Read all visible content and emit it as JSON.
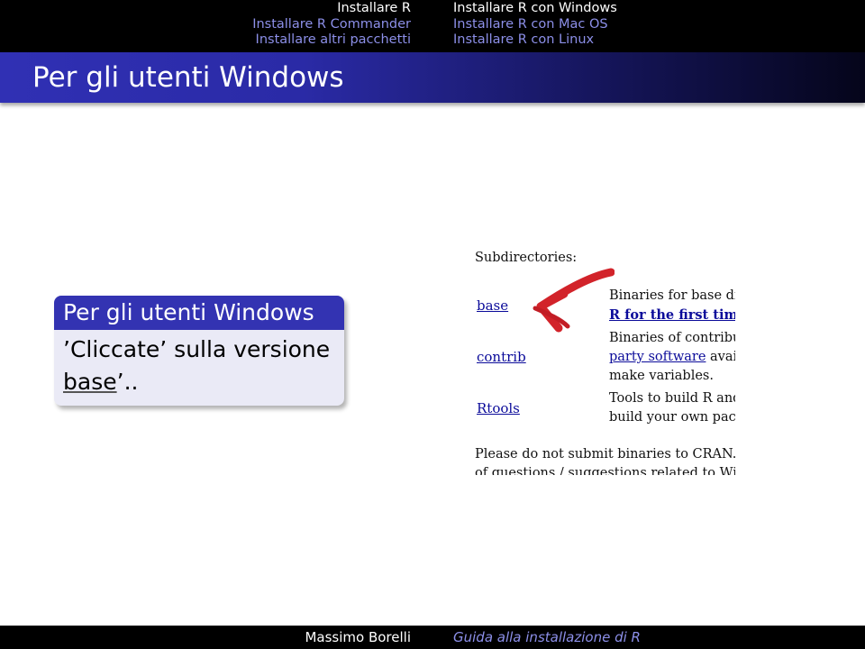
{
  "nav": {
    "left": [
      "Installare R",
      "Installare R Commander",
      "Installare altri pacchetti"
    ],
    "right": [
      "Installare R con Windows",
      "Installare R con Mac OS",
      "Installare R con Linux"
    ]
  },
  "frame": {
    "title": "Per gli utenti Windows"
  },
  "block": {
    "title": "Per gli utenti Windows",
    "line1": "’Cliccate’ sulla versione",
    "base_word": "base",
    "trail": "..",
    "trail_quote": "’"
  },
  "screenshot": {
    "subdirectories": "Subdirectories:",
    "links": {
      "base": "base",
      "contrib": "contrib",
      "rtools": "Rtools"
    },
    "desc": {
      "base_line1": "Binaries for base distr",
      "base_line2": "R for the first time",
      "base_line2_end": ".",
      "contrib_line1": "Binaries of contribute",
      "contrib_line2_link": "party software",
      "contrib_line2_end": " availab",
      "contrib_line3": "make variables.",
      "rtools_line1": "Tools to build R and I",
      "rtools_line2": "build your own packa"
    },
    "note_line1": "Please do not submit binaries to CRAN. Pacl",
    "note_line2": "of questions / suggestions related to Window"
  },
  "footer": {
    "author": "Massimo Borelli",
    "title": "Guida alla installazione di R"
  },
  "colors": {
    "accent": "#3333b2",
    "nav_inactive": "#8c8fe8",
    "arrow": "#d2232a",
    "block_bg": "#eaeaf6"
  }
}
